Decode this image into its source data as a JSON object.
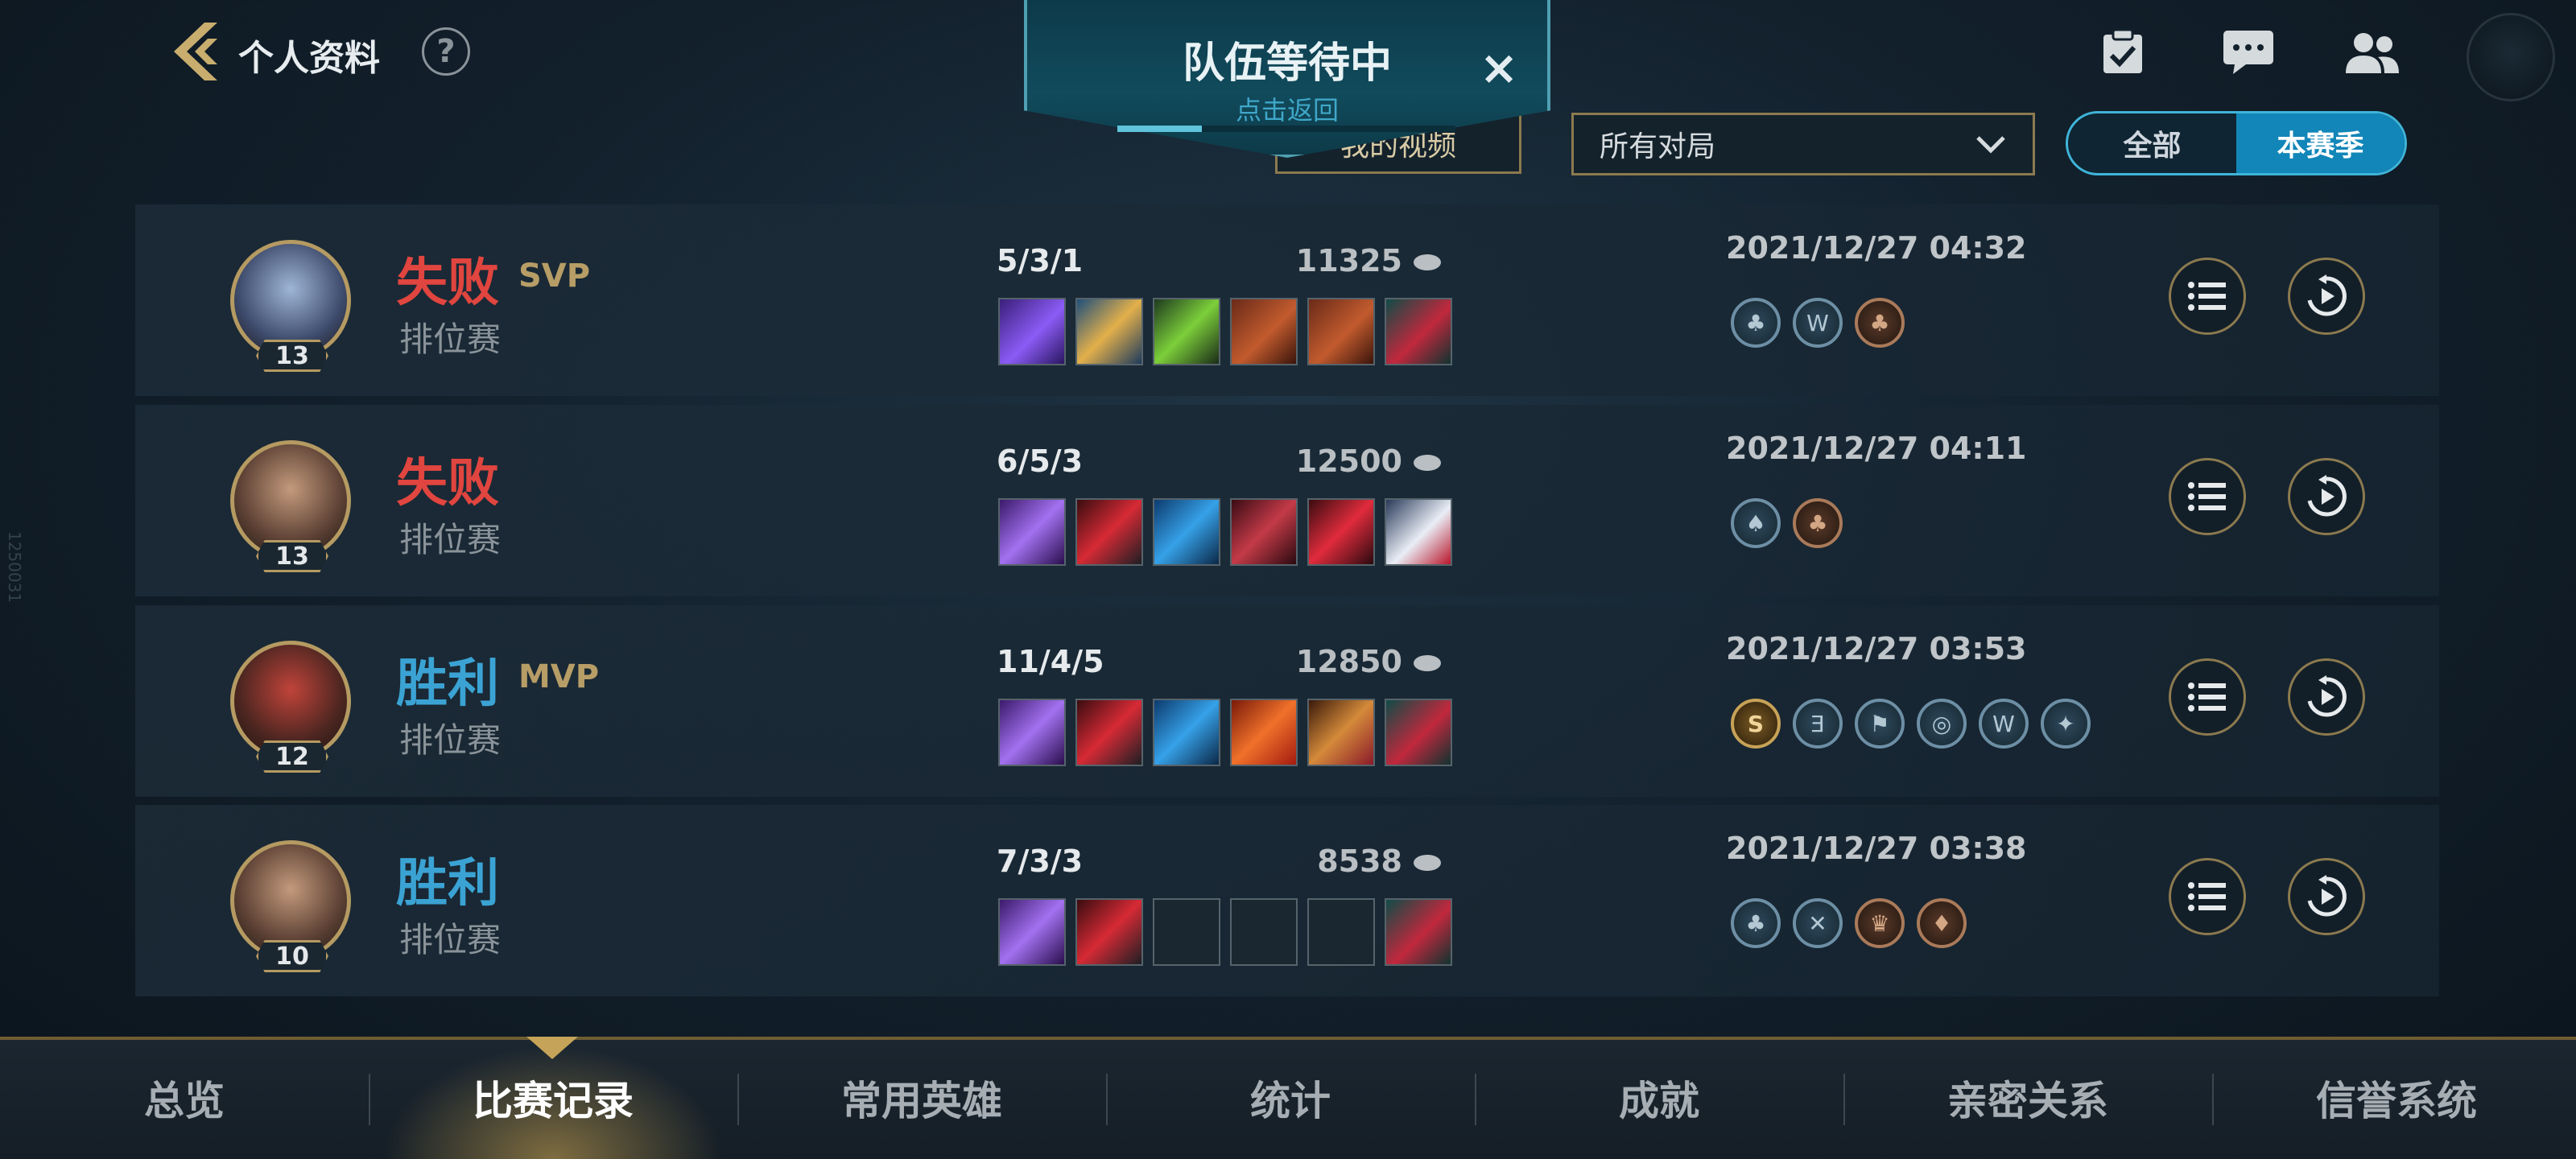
{
  "header": {
    "title": "个人资料",
    "help": "?"
  },
  "queue": {
    "title": "队伍等待中",
    "subtitle": "点击返回",
    "close": "×",
    "progress": 0.25
  },
  "filters": {
    "video_button": "我的视频",
    "match_type": "所有对局",
    "toggle_all": "全部",
    "toggle_season": "本赛季"
  },
  "matches": [
    {
      "result": "失败",
      "result_type": "loss",
      "badge": "SVP",
      "mode": "排位赛",
      "level": "13",
      "kda": "5/3/1",
      "gold": "11325",
      "datetime": "2021/12/27 04:32",
      "items": [
        "purple-staff",
        "golden-scepter",
        "green-claw",
        "red-tome",
        "red-tome",
        "red-boots"
      ],
      "medals": [
        "blue",
        "blue",
        "bronze"
      ],
      "hero_colors": [
        "#3d4a6b",
        "#9fb6d6"
      ]
    },
    {
      "result": "失败",
      "result_type": "loss",
      "badge": "",
      "mode": "排位赛",
      "level": "13",
      "kda": "6/5/3",
      "gold": "12500",
      "datetime": "2021/12/27 04:11",
      "items": [
        "purple-sword",
        "red-armor",
        "blue-dagger",
        "red-blade",
        "red-gem",
        "white-mask"
      ],
      "medals": [
        "blue",
        "bronze"
      ],
      "hero_colors": [
        "#5a3f33",
        "#c49a7c"
      ]
    },
    {
      "result": "胜利",
      "result_type": "win",
      "badge": "MVP",
      "mode": "排位赛",
      "level": "12",
      "kda": "11/4/5",
      "gold": "12850",
      "datetime": "2021/12/27 03:53",
      "items": [
        "purple-sword",
        "red-armor",
        "blue-dagger",
        "fire-orb",
        "gold-scythe",
        "red-boots"
      ],
      "medals": [
        "gold",
        "blue",
        "blue",
        "blue",
        "blue",
        "blue"
      ],
      "hero_colors": [
        "#4a2520",
        "#c0443a"
      ]
    },
    {
      "result": "胜利",
      "result_type": "win",
      "badge": "",
      "mode": "排位赛",
      "level": "10",
      "kda": "7/3/3",
      "gold": "8538",
      "datetime": "2021/12/27 03:38",
      "items": [
        "purple-sword",
        "red-armor",
        "",
        "",
        "",
        "red-boots"
      ],
      "medals": [
        "blue",
        "blue",
        "bronze",
        "bronze"
      ],
      "hero_colors": [
        "#5a3f33",
        "#c49a7c"
      ]
    }
  ],
  "medal_glyphs": {
    "m0_0": "♣",
    "m0_1": "W",
    "m0_2": "♣",
    "m1_0": "♠",
    "m1_1": "♣",
    "m2_0": "S",
    "m2_1": "Ǝ",
    "m2_2": "⚑",
    "m2_3": "◎",
    "m2_4": "W",
    "m2_5": "✦",
    "m3_0": "♣",
    "m3_1": "✕",
    "m3_2": "♛",
    "m3_3": "♦"
  },
  "colors": {
    "loss": "#e0453f",
    "win": "#3ba3d4",
    "accent_gold": "#b59a62",
    "accent_blue": "#1286b8"
  },
  "tabs": [
    "总览",
    "比赛记录",
    "常用英雄",
    "统计",
    "成就",
    "亲密关系",
    "信誉系统"
  ],
  "active_tab": "比赛记录",
  "side_text": "1250031"
}
